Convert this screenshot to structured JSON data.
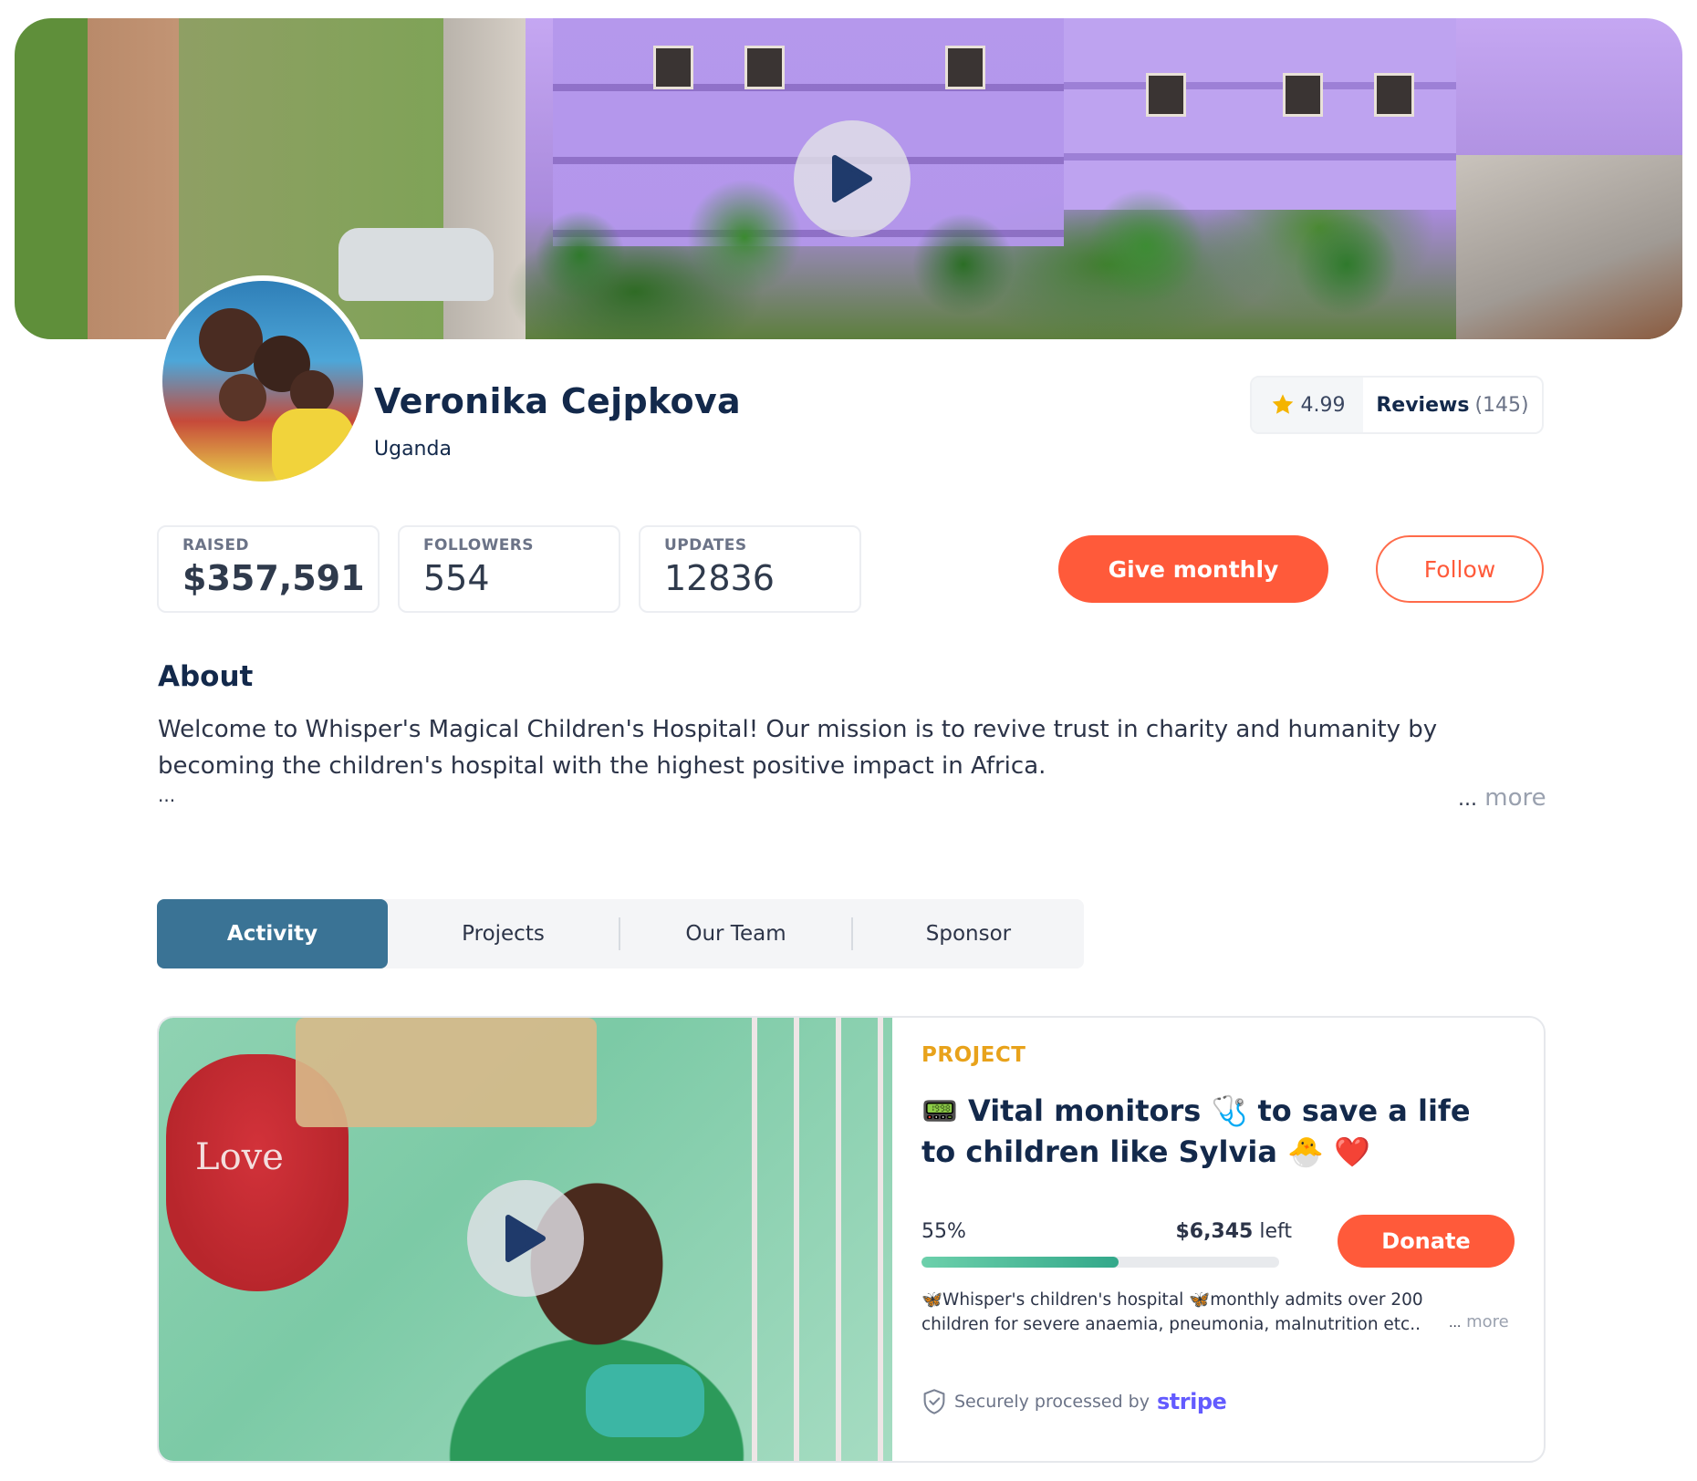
{
  "cover": {
    "play_icon": "play-icon"
  },
  "profile": {
    "name": "Veronika Cejpkova",
    "country": "Uganda",
    "rating": "4.99",
    "reviews_label": "Reviews",
    "reviews_count": "(145)"
  },
  "stats": [
    {
      "label": "RAISED",
      "value": "$357,591"
    },
    {
      "label": "FOLLOWERS",
      "value": "554"
    },
    {
      "label": "UPDATES",
      "value": "12836"
    }
  ],
  "actions": {
    "give_monthly": "Give monthly",
    "follow": "Follow"
  },
  "about": {
    "title": "About",
    "text": "Welcome to Whisper's Magical Children's Hospital! Our mission is to revive trust in charity and humanity by becoming the children's hospital with the highest positive impact in Africa.",
    "ellipsis": "...",
    "more_dots": "...",
    "more": "more"
  },
  "tabs": [
    {
      "label": "Activity",
      "active": true
    },
    {
      "label": "Projects",
      "active": false
    },
    {
      "label": "Our Team",
      "active": false
    },
    {
      "label": "Sponsor",
      "active": false
    }
  ],
  "project": {
    "tag": "PROJECT",
    "title": "📟 Vital monitors 🩺 to save a life to children like Sylvia 🐣 ❤️",
    "percent_label": "55%",
    "progress_fraction": 0.55,
    "left_amount": "$6,345",
    "left_label": "left",
    "donate": "Donate",
    "description": "🦋Whisper's children's hospital 🦋monthly admits over 200 children for severe anaemia, pneumonia, malnutrition etc..",
    "more_dots": "...",
    "more": "more",
    "secure_text": "Securely processed by",
    "stripe": "stripe"
  },
  "colors": {
    "accent": "#ff5a3a",
    "navy": "#13294b",
    "tab_active": "#3a7395",
    "project_tag": "#e8a21b",
    "progress": "#33a88a",
    "stripe": "#635bff"
  }
}
